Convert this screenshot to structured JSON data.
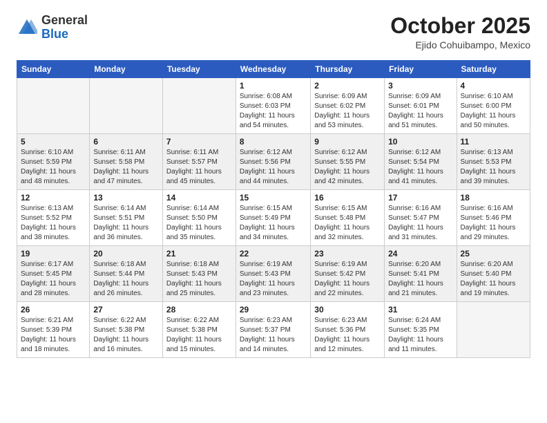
{
  "logo": {
    "general": "General",
    "blue": "Blue"
  },
  "title": "October 2025",
  "location": "Ejido Cohuibampo, Mexico",
  "weekdays": [
    "Sunday",
    "Monday",
    "Tuesday",
    "Wednesday",
    "Thursday",
    "Friday",
    "Saturday"
  ],
  "weeks": [
    [
      {
        "day": "",
        "info": ""
      },
      {
        "day": "",
        "info": ""
      },
      {
        "day": "",
        "info": ""
      },
      {
        "day": "1",
        "info": "Sunrise: 6:08 AM\nSunset: 6:03 PM\nDaylight: 11 hours\nand 54 minutes."
      },
      {
        "day": "2",
        "info": "Sunrise: 6:09 AM\nSunset: 6:02 PM\nDaylight: 11 hours\nand 53 minutes."
      },
      {
        "day": "3",
        "info": "Sunrise: 6:09 AM\nSunset: 6:01 PM\nDaylight: 11 hours\nand 51 minutes."
      },
      {
        "day": "4",
        "info": "Sunrise: 6:10 AM\nSunset: 6:00 PM\nDaylight: 11 hours\nand 50 minutes."
      }
    ],
    [
      {
        "day": "5",
        "info": "Sunrise: 6:10 AM\nSunset: 5:59 PM\nDaylight: 11 hours\nand 48 minutes."
      },
      {
        "day": "6",
        "info": "Sunrise: 6:11 AM\nSunset: 5:58 PM\nDaylight: 11 hours\nand 47 minutes."
      },
      {
        "day": "7",
        "info": "Sunrise: 6:11 AM\nSunset: 5:57 PM\nDaylight: 11 hours\nand 45 minutes."
      },
      {
        "day": "8",
        "info": "Sunrise: 6:12 AM\nSunset: 5:56 PM\nDaylight: 11 hours\nand 44 minutes."
      },
      {
        "day": "9",
        "info": "Sunrise: 6:12 AM\nSunset: 5:55 PM\nDaylight: 11 hours\nand 42 minutes."
      },
      {
        "day": "10",
        "info": "Sunrise: 6:12 AM\nSunset: 5:54 PM\nDaylight: 11 hours\nand 41 minutes."
      },
      {
        "day": "11",
        "info": "Sunrise: 6:13 AM\nSunset: 5:53 PM\nDaylight: 11 hours\nand 39 minutes."
      }
    ],
    [
      {
        "day": "12",
        "info": "Sunrise: 6:13 AM\nSunset: 5:52 PM\nDaylight: 11 hours\nand 38 minutes."
      },
      {
        "day": "13",
        "info": "Sunrise: 6:14 AM\nSunset: 5:51 PM\nDaylight: 11 hours\nand 36 minutes."
      },
      {
        "day": "14",
        "info": "Sunrise: 6:14 AM\nSunset: 5:50 PM\nDaylight: 11 hours\nand 35 minutes."
      },
      {
        "day": "15",
        "info": "Sunrise: 6:15 AM\nSunset: 5:49 PM\nDaylight: 11 hours\nand 34 minutes."
      },
      {
        "day": "16",
        "info": "Sunrise: 6:15 AM\nSunset: 5:48 PM\nDaylight: 11 hours\nand 32 minutes."
      },
      {
        "day": "17",
        "info": "Sunrise: 6:16 AM\nSunset: 5:47 PM\nDaylight: 11 hours\nand 31 minutes."
      },
      {
        "day": "18",
        "info": "Sunrise: 6:16 AM\nSunset: 5:46 PM\nDaylight: 11 hours\nand 29 minutes."
      }
    ],
    [
      {
        "day": "19",
        "info": "Sunrise: 6:17 AM\nSunset: 5:45 PM\nDaylight: 11 hours\nand 28 minutes."
      },
      {
        "day": "20",
        "info": "Sunrise: 6:18 AM\nSunset: 5:44 PM\nDaylight: 11 hours\nand 26 minutes."
      },
      {
        "day": "21",
        "info": "Sunrise: 6:18 AM\nSunset: 5:43 PM\nDaylight: 11 hours\nand 25 minutes."
      },
      {
        "day": "22",
        "info": "Sunrise: 6:19 AM\nSunset: 5:43 PM\nDaylight: 11 hours\nand 23 minutes."
      },
      {
        "day": "23",
        "info": "Sunrise: 6:19 AM\nSunset: 5:42 PM\nDaylight: 11 hours\nand 22 minutes."
      },
      {
        "day": "24",
        "info": "Sunrise: 6:20 AM\nSunset: 5:41 PM\nDaylight: 11 hours\nand 21 minutes."
      },
      {
        "day": "25",
        "info": "Sunrise: 6:20 AM\nSunset: 5:40 PM\nDaylight: 11 hours\nand 19 minutes."
      }
    ],
    [
      {
        "day": "26",
        "info": "Sunrise: 6:21 AM\nSunset: 5:39 PM\nDaylight: 11 hours\nand 18 minutes."
      },
      {
        "day": "27",
        "info": "Sunrise: 6:22 AM\nSunset: 5:38 PM\nDaylight: 11 hours\nand 16 minutes."
      },
      {
        "day": "28",
        "info": "Sunrise: 6:22 AM\nSunset: 5:38 PM\nDaylight: 11 hours\nand 15 minutes."
      },
      {
        "day": "29",
        "info": "Sunrise: 6:23 AM\nSunset: 5:37 PM\nDaylight: 11 hours\nand 14 minutes."
      },
      {
        "day": "30",
        "info": "Sunrise: 6:23 AM\nSunset: 5:36 PM\nDaylight: 11 hours\nand 12 minutes."
      },
      {
        "day": "31",
        "info": "Sunrise: 6:24 AM\nSunset: 5:35 PM\nDaylight: 11 hours\nand 11 minutes."
      },
      {
        "day": "",
        "info": ""
      }
    ]
  ]
}
